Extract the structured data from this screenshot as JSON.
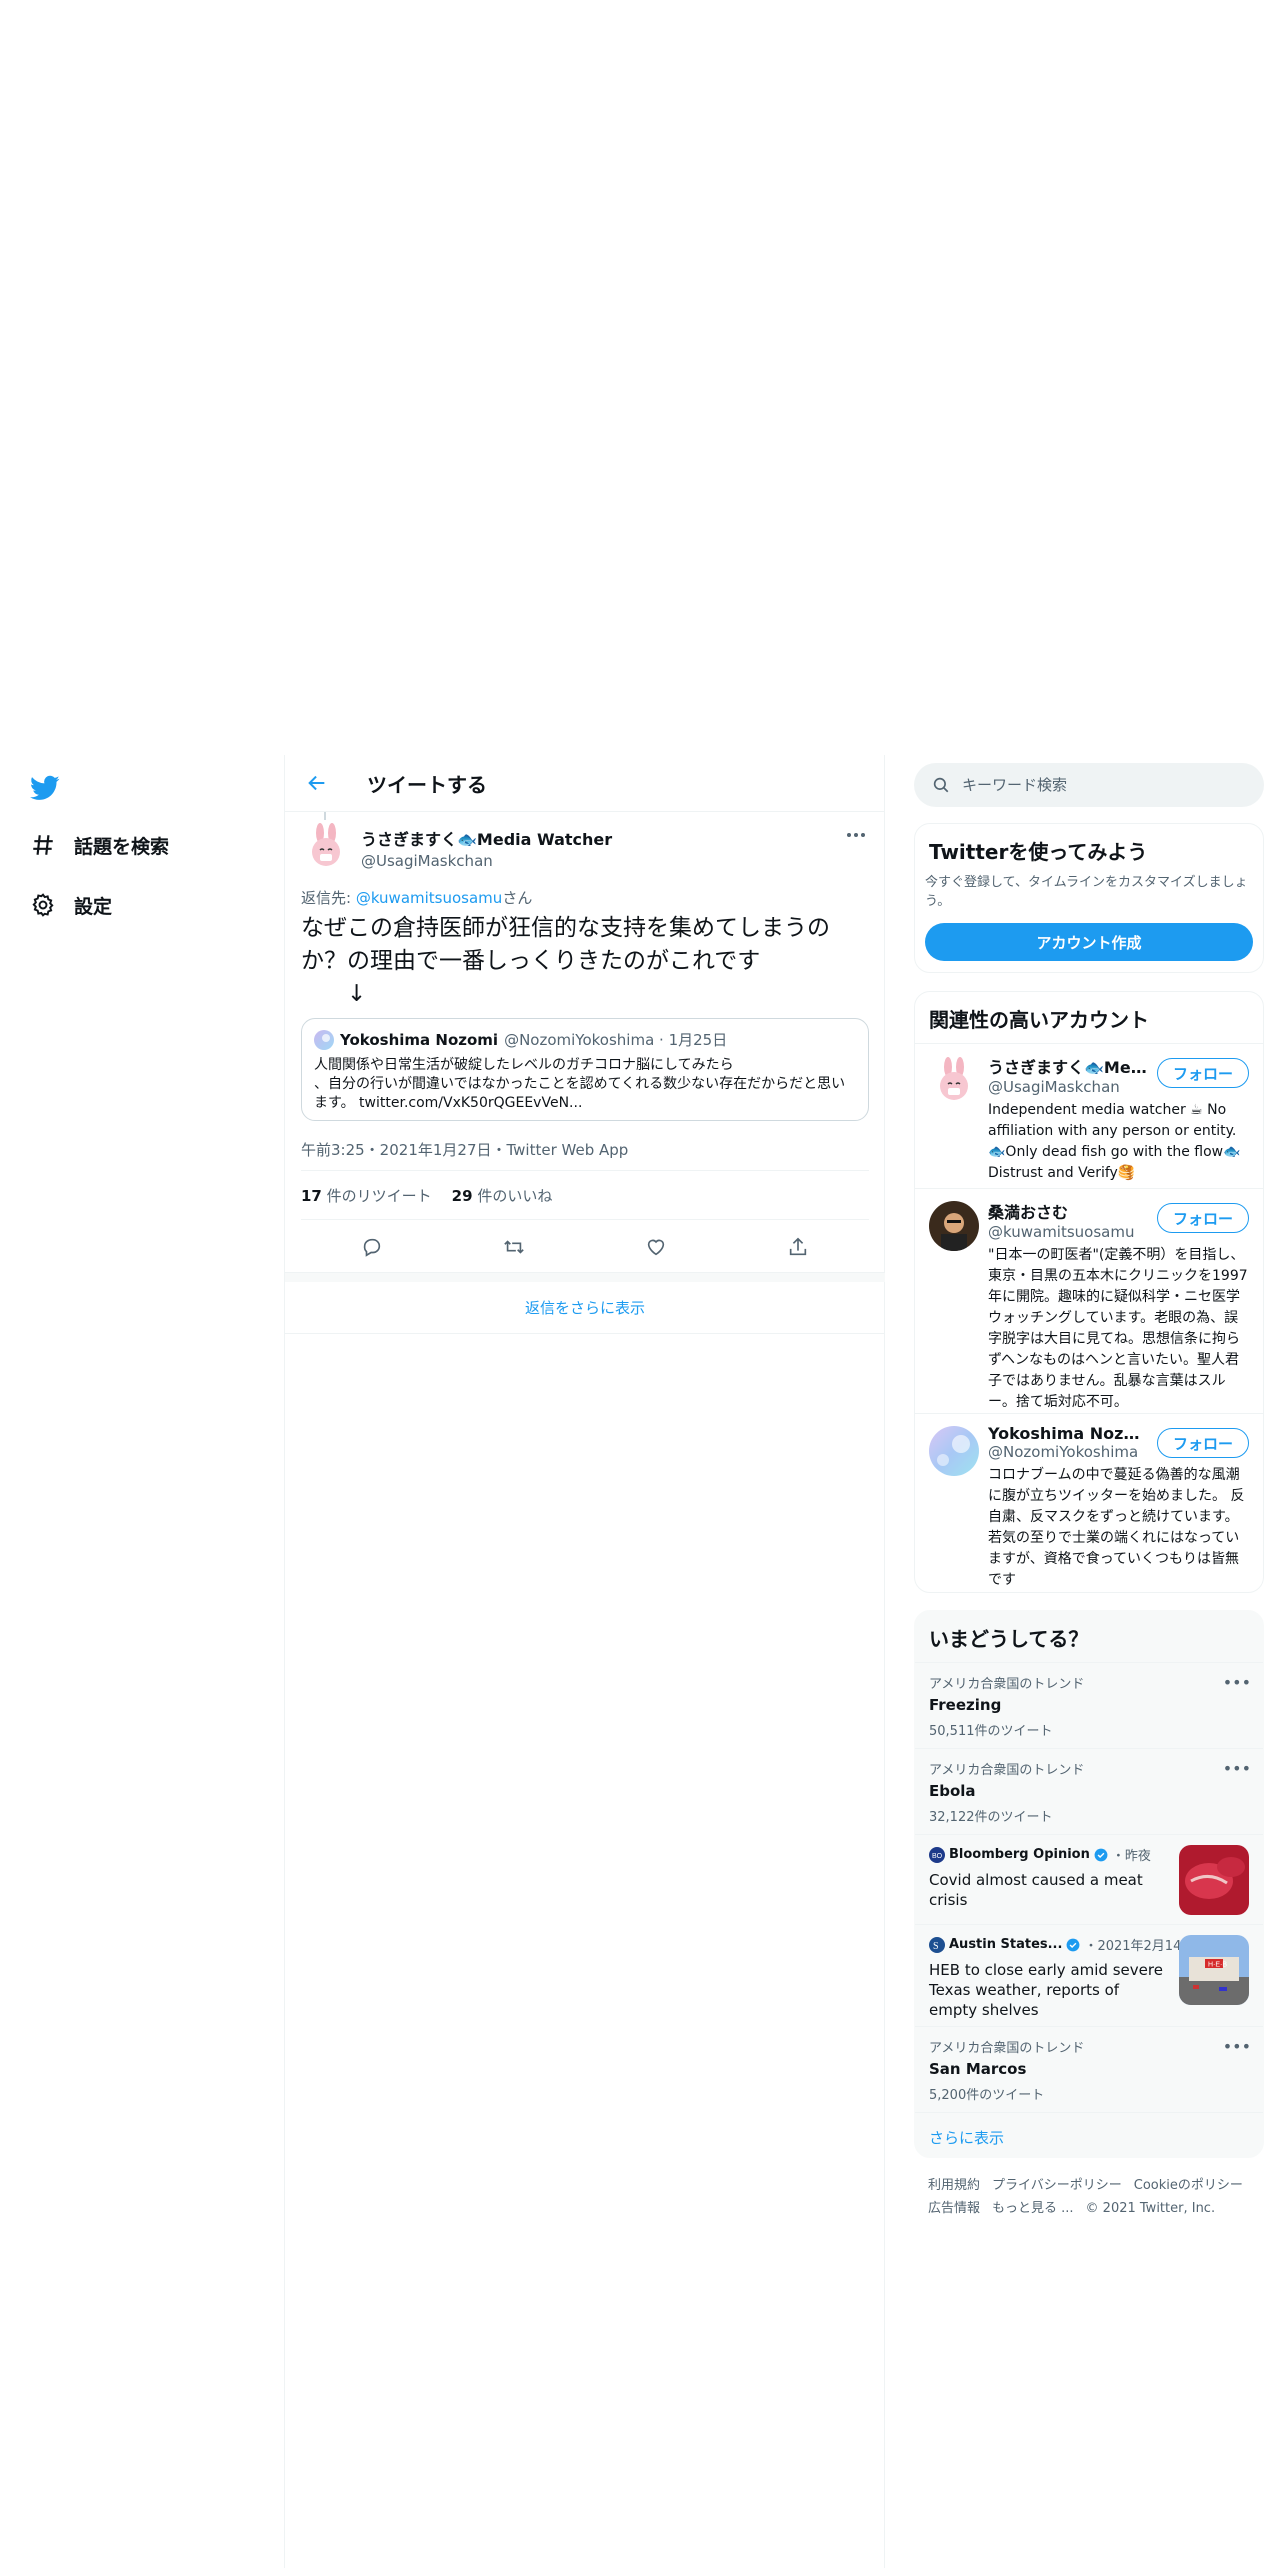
{
  "nav": {
    "explore_label": "話題を検索",
    "settings_label": "設定"
  },
  "header": {
    "title": "ツイートする"
  },
  "tweet": {
    "author_name": "うさぎますく🐟Media Watcher",
    "author_handle": "@UsagiMaskchan",
    "reply_prefix": "返信先: ",
    "reply_to": "@kuwamitsuosamu",
    "reply_suffix": "さん",
    "text": "なぜこの倉持医師が狂信的な支持を集めてしまうのか？の理由で一番しっくりきたのがこれです\n　　↓",
    "quote": {
      "name": "Yokoshima Nozomi",
      "handle_date": "@NozomiYokoshima · 1月25日",
      "text": "人間関係や日常生活が破綻したレベルのガチコロナ脳にしてみたら\n、自分の行いが間違いではなかったことを認めてくれる数少ない存在だからだと思います。 twitter.com/VxK50rQGEEvVeN..."
    },
    "meta": "午前3:25・2021年1月27日・Twitter Web App",
    "retweets_count": "17",
    "retweets_label": "件のリツイート",
    "likes_count": "29",
    "likes_label": "件のいいね"
  },
  "show_more_replies": "返信をさらに表示",
  "search": {
    "placeholder": "キーワード検索"
  },
  "signup": {
    "title": "Twitterを使ってみよう",
    "desc": "今すぐ登録して、タイムラインをカスタマイズしましょう。",
    "button": "アカウント作成"
  },
  "related": {
    "title": "関連性の高いアカウント",
    "follow_label": "フォロー",
    "accounts": [
      {
        "name": "うさぎますく🐟Medi...",
        "handle": "@UsagiMaskchan",
        "bio": "Independent media watcher ☕ No affiliation with any person or entity. 🐟Only dead fish go with the flow🐟 Distrust and Verify🥞"
      },
      {
        "name": "桑満おさむ",
        "handle": "@kuwamitsuosamu",
        "bio": "\"日本一の町医者\"(定義不明）を目指し、東京・目黒の五本木にクリニックを1997年に開院。趣味的に疑似科学・ニセ医学ウォッチングしています。老眼の為、誤字脱字は大目に見てね。思想信条に拘らずヘンなものはヘンと言いたい。聖人君子ではありません。乱暴な言葉はスルー。捨て垢対応不可。"
      },
      {
        "name": "Yokoshima Nozomi",
        "handle": "@NozomiYokoshima",
        "bio": "コロナブームの中で蔓延る偽善的な風潮に腹が立ちツイッターを始めました。 反自粛、反マスクをずっと続けています。若気の至りで士業の端くれにはなっていますが、資格で食っていくつもりは皆無です"
      }
    ]
  },
  "trends": {
    "title": "いまどうしてる？",
    "items": [
      {
        "context": "アメリカ合衆国のトレンド",
        "name": "Freezing",
        "count": "50,511件のツイート"
      },
      {
        "context": "アメリカ合衆国のトレンド",
        "name": "Ebola",
        "count": "32,122件のツイート"
      }
    ],
    "news": [
      {
        "source": "Bloomberg Opinion",
        "time": "・昨夜",
        "title": "Covid almost caused a meat crisis"
      },
      {
        "source": "Austin States...",
        "time": "・2021年2月14日",
        "title": "HEB to close early amid severe Texas weather, reports of empty shelves"
      }
    ],
    "last": {
      "context": "アメリカ合衆国のトレンド",
      "name": "San Marcos",
      "count": "5,200件のツイート"
    },
    "show_more": "さらに表示"
  },
  "footer": {
    "links": [
      "利用規約",
      "プライバシーポリシー",
      "Cookieのポリシー",
      "広告情報",
      "もっと見る ..."
    ],
    "copyright": "© 2021 Twitter, Inc."
  },
  "colors": {
    "accent": "#1d9bf0",
    "muted": "#536471",
    "border": "#eff3f4"
  }
}
